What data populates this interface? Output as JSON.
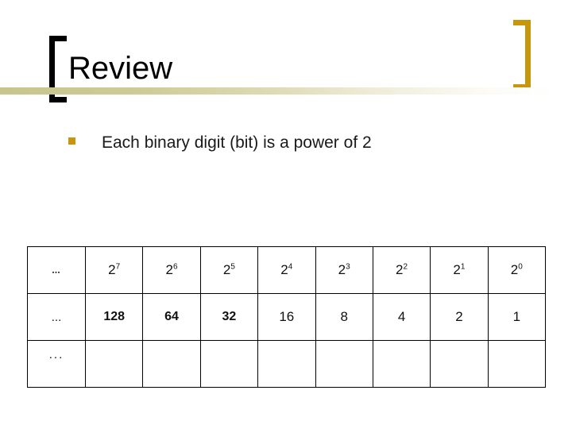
{
  "slide": {
    "title": "Review",
    "bullet": {
      "marker": "square-bullet",
      "text": "Each binary digit (bit) is a power of 2"
    },
    "decor": {
      "bracket_left_color": "#000000",
      "bracket_right_color": "#C8960C",
      "divider_color": "#c8c48c",
      "bullet_color": "#C8960C"
    }
  },
  "table": {
    "rows": [
      {
        "name": "exponent-row",
        "cells": [
          {
            "base": "…",
            "exp": "",
            "style": "ellipsis-bold"
          },
          {
            "base": "2",
            "exp": "7",
            "style": "power"
          },
          {
            "base": "2",
            "exp": "6",
            "style": "power"
          },
          {
            "base": "2",
            "exp": "5",
            "style": "power"
          },
          {
            "base": "2",
            "exp": "4",
            "style": "power"
          },
          {
            "base": "2",
            "exp": "3",
            "style": "power"
          },
          {
            "base": "2",
            "exp": "2",
            "style": "power"
          },
          {
            "base": "2",
            "exp": "1",
            "style": "power"
          },
          {
            "base": "2",
            "exp": "0",
            "style": "power"
          }
        ]
      },
      {
        "name": "value-row",
        "cells": [
          {
            "base": "...",
            "exp": "",
            "style": "ellipsis-plain"
          },
          {
            "base": "128",
            "exp": "",
            "style": "value-bold"
          },
          {
            "base": "64",
            "exp": "",
            "style": "value-bold"
          },
          {
            "base": "32",
            "exp": "",
            "style": "value-bold"
          },
          {
            "base": "16",
            "exp": "",
            "style": "value-plain"
          },
          {
            "base": "8",
            "exp": "",
            "style": "value-plain"
          },
          {
            "base": "4",
            "exp": "",
            "style": "value-plain"
          },
          {
            "base": "2",
            "exp": "",
            "style": "value-plain"
          },
          {
            "base": "1",
            "exp": "",
            "style": "value-plain"
          }
        ]
      },
      {
        "name": "empty-row",
        "cells": [
          {
            "base": "...",
            "exp": "",
            "style": "ellipsis-wide"
          },
          {
            "base": "",
            "exp": "",
            "style": "empty"
          },
          {
            "base": "",
            "exp": "",
            "style": "empty"
          },
          {
            "base": "",
            "exp": "",
            "style": "empty"
          },
          {
            "base": "",
            "exp": "",
            "style": "empty"
          },
          {
            "base": "",
            "exp": "",
            "style": "empty"
          },
          {
            "base": "",
            "exp": "",
            "style": "empty"
          },
          {
            "base": "",
            "exp": "",
            "style": "empty"
          },
          {
            "base": "",
            "exp": "",
            "style": "empty"
          }
        ]
      }
    ]
  }
}
